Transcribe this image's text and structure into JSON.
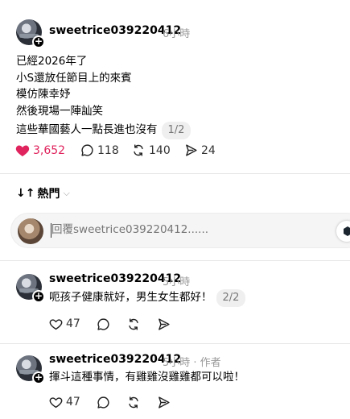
{
  "post": {
    "username": "sweetrice039220412",
    "time": "6小時",
    "lines": [
      "已經2026年了",
      "小S還放任節目上的來賓",
      "模仿陳幸妤",
      "然後現場一陣訕笑",
      "這些華國藝人一點長進也沒有"
    ],
    "page_indicator": "1/2",
    "likes": "3,652",
    "comments": "118",
    "reposts": "140",
    "shares": "24",
    "like_color": "#e0245e"
  },
  "sort": {
    "arrows": "↓↑",
    "label": "熱門",
    "chevron": "⌵"
  },
  "reply_box": {
    "placeholder": "回覆sweetrice039220412......"
  },
  "replies": [
    {
      "username": "sweetrice039220412",
      "time": "5小時",
      "author_tag": "",
      "text": "呃孩子健康就好，男生女生都好！",
      "page_indicator": "2/2",
      "likes": "47"
    },
    {
      "username": "sweetrice039220412",
      "time": "5小時",
      "author_tag": "· 作者",
      "text": "揮斗這種事情，有雞雞沒雞雞都可以啦！",
      "page_indicator": "",
      "likes": "47"
    }
  ]
}
